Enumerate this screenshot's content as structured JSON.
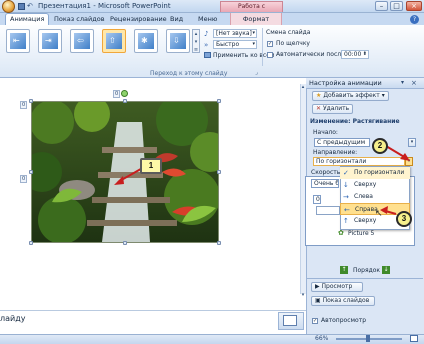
{
  "window": {
    "title": "Презентация1 - Microsoft PowerPoint",
    "context_tab_group": "Работа с рисунками",
    "minimize": "–",
    "maximize": "□",
    "close": "×"
  },
  "tabs": [
    {
      "label": "Анимация",
      "active": true
    },
    {
      "label": "Показ слайдов"
    },
    {
      "label": "Рецензирование"
    },
    {
      "label": "Вид"
    },
    {
      "label": "Меню"
    },
    {
      "label": "Формат",
      "context": true
    }
  ],
  "ribbon": {
    "sound_value": "[Нет звука]",
    "speed_value": "Быстро",
    "apply_all_label": "Применить ко всем",
    "change_slide_label": "Смена слайда",
    "on_click_label": "По щелчку",
    "auto_after_label": "Автоматически после:",
    "auto_time_value": "00:00",
    "group_label": "Переход к этому слайду"
  },
  "pane": {
    "title": "Настройка анимации",
    "add_effect": "Добавить эффект ▾",
    "remove": "Удалить",
    "change_label": "Изменение: Растягивание",
    "start_label": "Начало:",
    "start_value": "С предыдущим",
    "direction_label": "Направление:",
    "direction_value": "По горизонтали",
    "speed_label": "Скорость:",
    "speed_value": "Очень быс",
    "list_item_num": "0",
    "list_item_picture": "Picture 5",
    "order_label": "Порядок",
    "preview": "Просмотр",
    "slideshow": "Показ слайдов",
    "autopreview": "Автопросмотр"
  },
  "direction_options": [
    {
      "label": "По горизонтали",
      "icon": "✓",
      "state": "checked"
    },
    {
      "label": "Сверху",
      "icon": "↓"
    },
    {
      "label": "Слева",
      "icon": "→"
    },
    {
      "label": "Справа",
      "icon": "←",
      "state": "highlighted"
    },
    {
      "label": "Сверху",
      "icon": "↑"
    }
  ],
  "slide": {
    "handle_label_left": "0",
    "handle_label_top": "0",
    "handle_label_left_mid": "0"
  },
  "notes_text": "лайду",
  "callouts": [
    "1",
    "2",
    "3"
  ],
  "status": {
    "zoom": "66%"
  },
  "colors": {
    "ribbon_bg": "#dbe7f5",
    "context_tab": "#e9a7b4",
    "highlight": "#ffe08f",
    "callout": "#f6f08c"
  }
}
